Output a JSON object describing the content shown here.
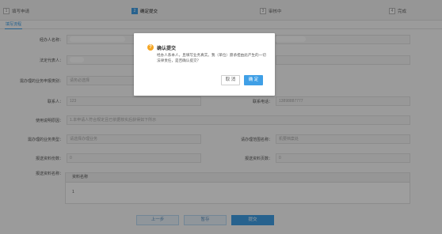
{
  "steps": [
    {
      "num": "1",
      "label": "填写申请"
    },
    {
      "num": "2",
      "label": "确定提交"
    },
    {
      "num": "3",
      "label": "审核中"
    },
    {
      "num": "4",
      "label": "完成"
    }
  ],
  "tab": "填写流程",
  "form": {
    "handler_name_label": "经办人名称：",
    "legal_rep_label": "法定代表人：",
    "bid_type_label": "需办理的业务申报类别：",
    "bid_type_placeholder": "请务必选择",
    "contact_label": "联系人：",
    "contact_value": "123",
    "phone_label": "联系电话：",
    "phone_value": "13898887777",
    "reason_label": "使用说明原因：",
    "reason_value": "1.本申请人符合规定且已依据核实后获得如下所示",
    "bid_org_label": "需办理的业务类型：",
    "bid_org_value": "请选择办理业务",
    "dept_label": "请办理范围名称：",
    "dept_value": "机要档案处",
    "count_label": "报送资料份数：",
    "count_value": "0",
    "pages_label": "报送资料页数：",
    "pages_value": "0",
    "list_label": "报送资料名称：",
    "table_header": "资料名称",
    "table_row": "1"
  },
  "buttons": {
    "prev": "上一步",
    "save": "暂存",
    "submit": "提交"
  },
  "dialog": {
    "icon": "?",
    "title": "确认提交",
    "body": "经办人系本人，且填写业务真实。我（单位）愿承担由此产生的一切法律责任，是否确认提交？",
    "cancel": "取 消",
    "ok": "确 定"
  }
}
